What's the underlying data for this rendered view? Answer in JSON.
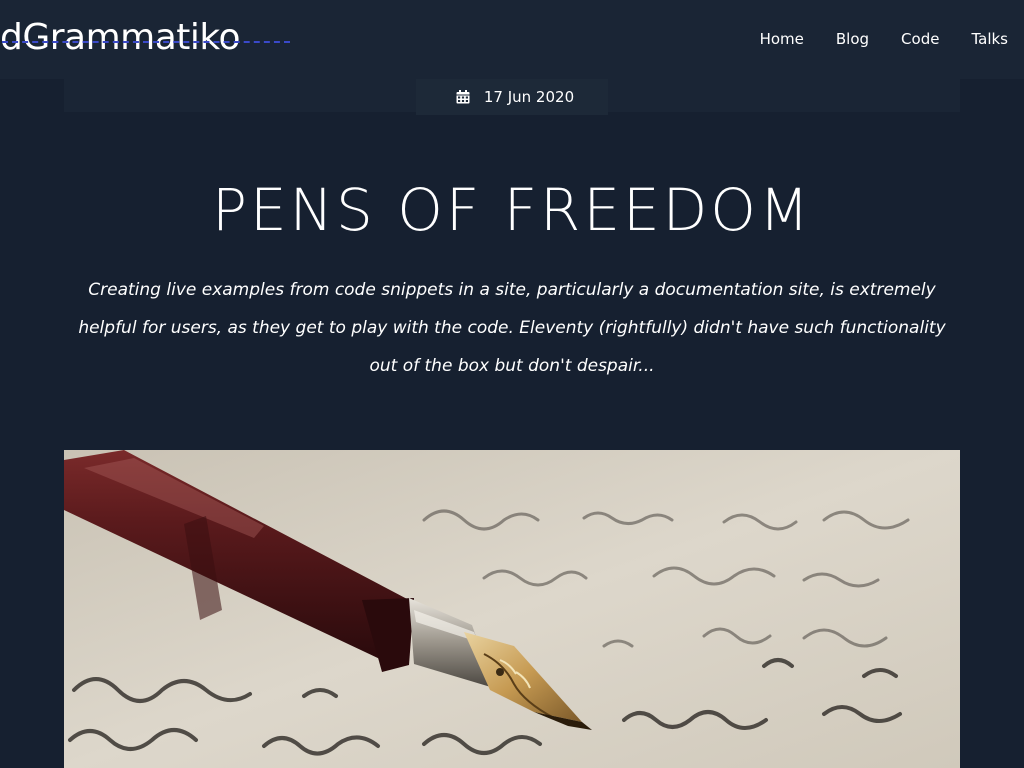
{
  "site": {
    "logo_text": "dGrammatiko"
  },
  "nav": {
    "items": [
      {
        "label": "Home"
      },
      {
        "label": "Blog"
      },
      {
        "label": "Code"
      },
      {
        "label": "Talks"
      }
    ]
  },
  "post": {
    "date": "17 Jun 2020",
    "date_icon": "calendar-icon",
    "title": "PENS OF FREEDOM",
    "excerpt": "Creating live examples from code snippets in a site, particularly a documentation site, is extremely helpful for users, as they get to play with the code. Eleventy (rightfully) didn't have such functionality out of the box but don't despair...",
    "hero_image": "fountain-pen-on-handwritten-letter-image"
  },
  "colors": {
    "page_background": "#162030",
    "header_background": "#1a2535",
    "text": "#ffffff",
    "logo_underline": "#3a49c9"
  }
}
